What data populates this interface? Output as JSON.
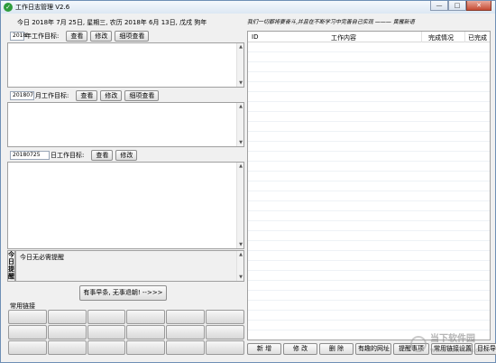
{
  "window": {
    "title": "工作日志管理 V2.6",
    "buttons": {
      "minimize": "—",
      "maximize": "□",
      "close": "✕"
    }
  },
  "date_line": "今日 2018年 7月 25日, 星期三, 农历 2018年 6月 13日, 戊戌 狗年",
  "quote": "我们一切都将要奋斗,并且在不断学习中完善自己实现 ——— 黄雁新语",
  "year_goal": {
    "value": "2018",
    "label": "年工作目标:",
    "view": "查看",
    "edit": "修改",
    "detail": "细项查看"
  },
  "month_goal": {
    "value": "201807",
    "label": "月工作目标:",
    "view": "查看",
    "edit": "修改",
    "detail": "细项查看"
  },
  "day_goal": {
    "value": "20180725",
    "label": "日工作目标:",
    "view": "查看",
    "edit": "修改"
  },
  "reminder": {
    "side_label": "今日提醒",
    "text": "今日无必需提醒"
  },
  "action_button": "有事早条, 无事退朝! -->>>",
  "common_links_label": "常用链接",
  "table": {
    "columns": [
      "ID",
      "工作内容",
      "完成情况",
      "已完成"
    ]
  },
  "bottom_buttons": [
    "新 增",
    "修 改",
    "删 除",
    "有趣的网址",
    "提醒事项",
    "常用链接设置",
    "目标导出"
  ],
  "watermark": {
    "title": "当下软件园",
    "url": "www.downxia.com"
  },
  "colors": {
    "titlebar": "#dce7f3",
    "window_bg": "#f0f0f0",
    "close": "#c54a32"
  }
}
